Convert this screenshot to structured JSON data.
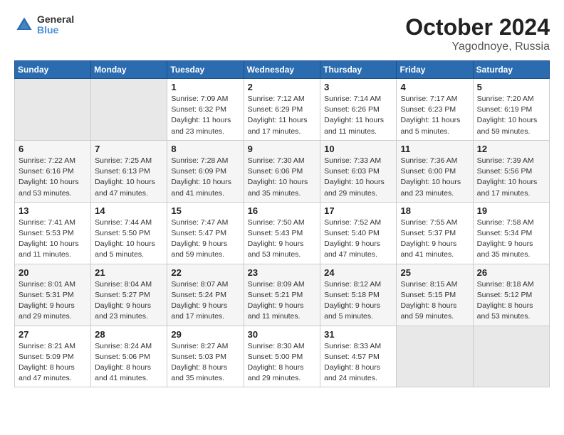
{
  "logo": {
    "line1": "General",
    "line2": "Blue"
  },
  "title": "October 2024",
  "subtitle": "Yagodnoye, Russia",
  "days_of_week": [
    "Sunday",
    "Monday",
    "Tuesday",
    "Wednesday",
    "Thursday",
    "Friday",
    "Saturday"
  ],
  "weeks": [
    [
      {
        "day": "",
        "info": ""
      },
      {
        "day": "",
        "info": ""
      },
      {
        "day": "1",
        "sunrise": "7:09 AM",
        "sunset": "6:32 PM",
        "daylight": "11 hours and 23 minutes."
      },
      {
        "day": "2",
        "sunrise": "7:12 AM",
        "sunset": "6:29 PM",
        "daylight": "11 hours and 17 minutes."
      },
      {
        "day": "3",
        "sunrise": "7:14 AM",
        "sunset": "6:26 PM",
        "daylight": "11 hours and 11 minutes."
      },
      {
        "day": "4",
        "sunrise": "7:17 AM",
        "sunset": "6:23 PM",
        "daylight": "11 hours and 5 minutes."
      },
      {
        "day": "5",
        "sunrise": "7:20 AM",
        "sunset": "6:19 PM",
        "daylight": "10 hours and 59 minutes."
      }
    ],
    [
      {
        "day": "6",
        "sunrise": "7:22 AM",
        "sunset": "6:16 PM",
        "daylight": "10 hours and 53 minutes."
      },
      {
        "day": "7",
        "sunrise": "7:25 AM",
        "sunset": "6:13 PM",
        "daylight": "10 hours and 47 minutes."
      },
      {
        "day": "8",
        "sunrise": "7:28 AM",
        "sunset": "6:09 PM",
        "daylight": "10 hours and 41 minutes."
      },
      {
        "day": "9",
        "sunrise": "7:30 AM",
        "sunset": "6:06 PM",
        "daylight": "10 hours and 35 minutes."
      },
      {
        "day": "10",
        "sunrise": "7:33 AM",
        "sunset": "6:03 PM",
        "daylight": "10 hours and 29 minutes."
      },
      {
        "day": "11",
        "sunrise": "7:36 AM",
        "sunset": "6:00 PM",
        "daylight": "10 hours and 23 minutes."
      },
      {
        "day": "12",
        "sunrise": "7:39 AM",
        "sunset": "5:56 PM",
        "daylight": "10 hours and 17 minutes."
      }
    ],
    [
      {
        "day": "13",
        "sunrise": "7:41 AM",
        "sunset": "5:53 PM",
        "daylight": "10 hours and 11 minutes."
      },
      {
        "day": "14",
        "sunrise": "7:44 AM",
        "sunset": "5:50 PM",
        "daylight": "10 hours and 5 minutes."
      },
      {
        "day": "15",
        "sunrise": "7:47 AM",
        "sunset": "5:47 PM",
        "daylight": "9 hours and 59 minutes."
      },
      {
        "day": "16",
        "sunrise": "7:50 AM",
        "sunset": "5:43 PM",
        "daylight": "9 hours and 53 minutes."
      },
      {
        "day": "17",
        "sunrise": "7:52 AM",
        "sunset": "5:40 PM",
        "daylight": "9 hours and 47 minutes."
      },
      {
        "day": "18",
        "sunrise": "7:55 AM",
        "sunset": "5:37 PM",
        "daylight": "9 hours and 41 minutes."
      },
      {
        "day": "19",
        "sunrise": "7:58 AM",
        "sunset": "5:34 PM",
        "daylight": "9 hours and 35 minutes."
      }
    ],
    [
      {
        "day": "20",
        "sunrise": "8:01 AM",
        "sunset": "5:31 PM",
        "daylight": "9 hours and 29 minutes."
      },
      {
        "day": "21",
        "sunrise": "8:04 AM",
        "sunset": "5:27 PM",
        "daylight": "9 hours and 23 minutes."
      },
      {
        "day": "22",
        "sunrise": "8:07 AM",
        "sunset": "5:24 PM",
        "daylight": "9 hours and 17 minutes."
      },
      {
        "day": "23",
        "sunrise": "8:09 AM",
        "sunset": "5:21 PM",
        "daylight": "9 hours and 11 minutes."
      },
      {
        "day": "24",
        "sunrise": "8:12 AM",
        "sunset": "5:18 PM",
        "daylight": "9 hours and 5 minutes."
      },
      {
        "day": "25",
        "sunrise": "8:15 AM",
        "sunset": "5:15 PM",
        "daylight": "8 hours and 59 minutes."
      },
      {
        "day": "26",
        "sunrise": "8:18 AM",
        "sunset": "5:12 PM",
        "daylight": "8 hours and 53 minutes."
      }
    ],
    [
      {
        "day": "27",
        "sunrise": "8:21 AM",
        "sunset": "5:09 PM",
        "daylight": "8 hours and 47 minutes."
      },
      {
        "day": "28",
        "sunrise": "8:24 AM",
        "sunset": "5:06 PM",
        "daylight": "8 hours and 41 minutes."
      },
      {
        "day": "29",
        "sunrise": "8:27 AM",
        "sunset": "5:03 PM",
        "daylight": "8 hours and 35 minutes."
      },
      {
        "day": "30",
        "sunrise": "8:30 AM",
        "sunset": "5:00 PM",
        "daylight": "8 hours and 29 minutes."
      },
      {
        "day": "31",
        "sunrise": "8:33 AM",
        "sunset": "4:57 PM",
        "daylight": "8 hours and 24 minutes."
      },
      {
        "day": "",
        "info": ""
      },
      {
        "day": "",
        "info": ""
      }
    ]
  ],
  "labels": {
    "sunrise": "Sunrise:",
    "sunset": "Sunset:",
    "daylight": "Daylight:"
  }
}
